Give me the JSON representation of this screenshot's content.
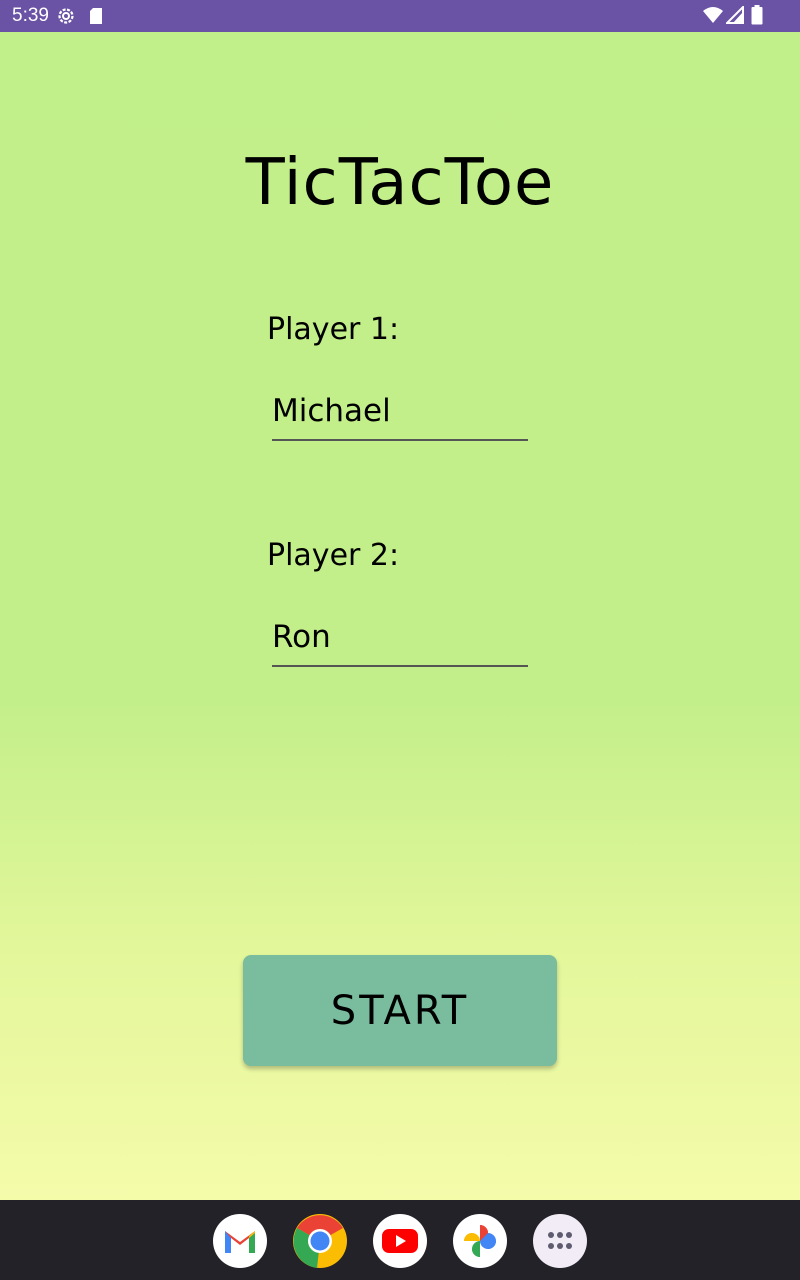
{
  "status_bar": {
    "time": "5:39",
    "icons": [
      "settings-icon",
      "sd-card-icon",
      "wifi-icon",
      "signal-icon",
      "battery-icon"
    ],
    "background": "#6a52a4"
  },
  "app": {
    "title": "TicTacToe",
    "player1": {
      "label": "Player 1:",
      "value": "Michael"
    },
    "player2": {
      "label": "Player 2:",
      "value": "Ron"
    },
    "start_label": "START",
    "start_color": "#7abc9e"
  },
  "dock": {
    "apps": [
      "gmail-icon",
      "chrome-icon",
      "youtube-icon",
      "photos-icon",
      "app-drawer-icon"
    ],
    "background": "#232228"
  }
}
